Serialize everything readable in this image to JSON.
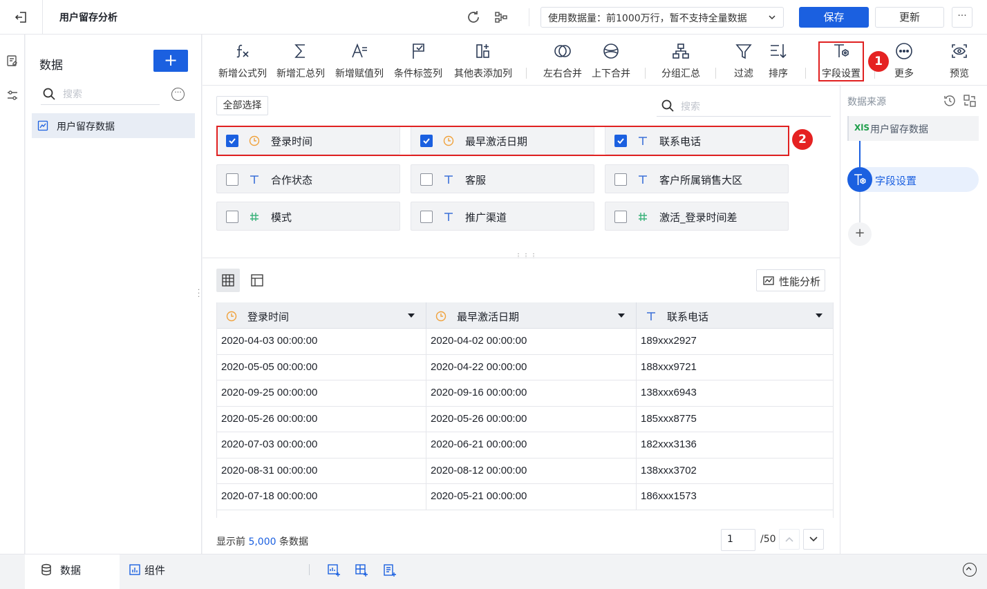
{
  "header": {
    "title": "用户留存分析",
    "data_select": "使用数据量：前1000万行，暂不支持全量数据",
    "save_label": "保存",
    "update_label": "更新",
    "more_label": "···"
  },
  "left_panel": {
    "title": "数据",
    "add_label": "+",
    "search_placeholder": "搜索",
    "items": [
      {
        "label": "用户留存数据"
      }
    ]
  },
  "toolbar": {
    "items": [
      {
        "label": "新增公式列",
        "icon": "formula-icon"
      },
      {
        "label": "新增汇总列",
        "icon": "sigma-icon"
      },
      {
        "label": "新增赋值列",
        "icon": "assign-icon"
      },
      {
        "label": "条件标签列",
        "icon": "flag-icon"
      },
      {
        "label": "其他表添加列",
        "icon": "add-column-icon"
      },
      {
        "label": "左右合并",
        "icon": "merge-lr-icon"
      },
      {
        "label": "上下合并",
        "icon": "merge-tb-icon"
      },
      {
        "label": "分组汇总",
        "icon": "group-icon"
      },
      {
        "label": "过滤",
        "icon": "filter-icon"
      },
      {
        "label": "排序",
        "icon": "sort-icon"
      },
      {
        "label": "字段设置",
        "icon": "field-settings-icon"
      },
      {
        "label": "更多",
        "icon": "more-icon"
      },
      {
        "label": "预览",
        "icon": "preview-icon"
      }
    ]
  },
  "annotations": {
    "badge1": "1",
    "badge2": "2"
  },
  "fields": {
    "select_all_label": "全部选择",
    "search_placeholder": "搜索",
    "items": [
      {
        "label": "登录时间",
        "type": "date",
        "checked": true
      },
      {
        "label": "最早激活日期",
        "type": "date",
        "checked": true
      },
      {
        "label": "联系电话",
        "type": "text",
        "checked": true
      },
      {
        "label": "合作状态",
        "type": "text",
        "checked": false
      },
      {
        "label": "客服",
        "type": "text",
        "checked": false
      },
      {
        "label": "客户所属销售大区",
        "type": "text",
        "checked": false
      },
      {
        "label": "模式",
        "type": "number",
        "checked": false
      },
      {
        "label": "推广渠道",
        "type": "text",
        "checked": false
      },
      {
        "label": "激活_登录时间差",
        "type": "number",
        "checked": false
      }
    ]
  },
  "preview": {
    "perf_label": "性能分析",
    "columns": [
      {
        "label": "登录时间",
        "type": "date"
      },
      {
        "label": "最早激活日期",
        "type": "date"
      },
      {
        "label": "联系电话",
        "type": "text"
      }
    ],
    "rows": [
      [
        "2020-04-03 00:00:00",
        "2020-04-02 00:00:00",
        "189xxx2927"
      ],
      [
        "2020-05-05 00:00:00",
        "2020-04-22 00:00:00",
        "188xxx9721"
      ],
      [
        "2020-09-25 00:00:00",
        "2020-09-16 00:00:00",
        "138xxx6943"
      ],
      [
        "2020-05-26 00:00:00",
        "2020-05-26 00:00:00",
        "185xxx8775"
      ],
      [
        "2020-07-03 00:00:00",
        "2020-06-21 00:00:00",
        "182xxx3136"
      ],
      [
        "2020-08-31 00:00:00",
        "2020-08-12 00:00:00",
        "138xxx3702"
      ],
      [
        "2020-07-18 00:00:00",
        "2020-05-21 00:00:00",
        "186xxx1573"
      ]
    ],
    "footer_prefix": "显示前",
    "footer_count": "5,000",
    "footer_suffix": "条数据",
    "page_value": "1",
    "page_total": "/50"
  },
  "right_panel": {
    "title": "数据来源",
    "source_label": "用户留存数据",
    "source_badge": "XlS",
    "step_label": "字段设置",
    "add_label": "+"
  },
  "bottom": {
    "tab_data": "数据",
    "tab_component": "组件"
  },
  "colors": {
    "accent": "#1b60e0",
    "highlight": "#e02020",
    "date_icon": "#f0a23c",
    "text_icon": "#3a6fd8",
    "number_icon": "#3ab27a"
  }
}
